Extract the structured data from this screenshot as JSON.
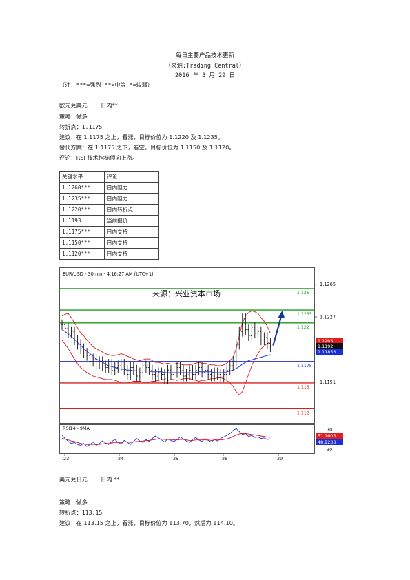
{
  "header": {
    "title": "每日主要产品技术更新",
    "source": "（来源:Trading Central）",
    "date": "2016 年 3 月 29 日",
    "note": "（注：***=强烈 **=中等 *=较弱）"
  },
  "eurusd": {
    "pair": "欧元兑美元",
    "term": "日内**",
    "strategy": "策略：做多",
    "pivot": "转折点：1.1175",
    "advice": "建议：在 1.1175 之上，看涨，目标价位为 1.1220 及 1.1235。",
    "alternative": "替代方案：在 1.1175 之下，看空，目标价位为 1.1150 及 1.1120。",
    "comment": "评论：RSI 技术指标倾向上涨。"
  },
  "levels_table": {
    "headers": [
      "关键水平",
      "评论"
    ],
    "rows": [
      [
        "1.1260***",
        "日内阻力"
      ],
      [
        "1.1235***",
        "日内阻力"
      ],
      [
        "1.1220***",
        "日内转折点"
      ],
      [
        "1.1193",
        "当前报价"
      ],
      [
        "1.1175***",
        "日内支持"
      ],
      [
        "1.1150***",
        "日内支持"
      ],
      [
        "1.1120***",
        "日内支持"
      ]
    ]
  },
  "chart_data": {
    "type": "line",
    "title": "EUR/USD - 30min - 4:16:27 AM (UTC+1)",
    "watermark": "来源：兴业资本市场",
    "x_ticks": [
      "23",
      "24",
      "25",
      "28",
      "29"
    ],
    "y_axis_ticks": [
      "1.1265",
      "1.1227",
      "1.1151"
    ],
    "levels": [
      {
        "value": 1.126,
        "label": "1.126",
        "color": "#1e9a1e"
      },
      {
        "value": 1.1235,
        "label": "1.1235",
        "color": "#1e9a1e"
      },
      {
        "value": 1.122,
        "label": "1.122",
        "color": "#1e9a1e"
      },
      {
        "value": 1.1175,
        "label": "1.1175",
        "color": "#1a2fd6"
      },
      {
        "value": 1.115,
        "label": "1.115",
        "color": "#d62020"
      },
      {
        "value": 1.112,
        "label": "1.112",
        "color": "#d62020"
      }
    ],
    "price_tags": [
      {
        "value": 1.1203,
        "label": "1.1203",
        "bg": "#e02020"
      },
      {
        "value": 1.1192,
        "label": "1.1192",
        "bg": "#111111"
      },
      {
        "value": 1.11833,
        "label": "1.11833",
        "bg": "#1a2fd6"
      }
    ],
    "ylim": [
      1.1105,
      1.1272
    ],
    "close": [
      1.1218,
      1.1214,
      1.1208,
      1.121,
      1.12,
      1.1195,
      1.119,
      1.1185,
      1.1182,
      1.1175,
      1.1178,
      1.1172,
      1.1175,
      1.117,
      1.1168,
      1.1172,
      1.1165,
      1.1168,
      1.117,
      1.1172,
      1.1165,
      1.116,
      1.1168,
      1.1165,
      1.1158,
      1.1162,
      1.117,
      1.1168,
      1.1165,
      1.116,
      1.1158,
      1.1162,
      1.116,
      1.1155,
      1.1165,
      1.116,
      1.1162,
      1.1168,
      1.1165,
      1.1158,
      1.116,
      1.1165,
      1.116,
      1.1165,
      1.1168,
      1.1162,
      1.1165,
      1.116,
      1.1158,
      1.1162,
      1.116,
      1.1157,
      1.116,
      1.1165,
      1.117,
      1.1175,
      1.1195,
      1.121,
      1.1225,
      1.1212,
      1.1205,
      1.1215,
      1.1208,
      1.121,
      1.12,
      1.1203,
      1.1196,
      1.1192
    ],
    "sma": [
      1.1212,
      1.121,
      1.1207,
      1.1204,
      1.1201,
      1.1197,
      1.1194,
      1.119,
      1.1187,
      1.1184,
      1.1181,
      1.1178,
      1.1176,
      1.1174,
      1.1172,
      1.117,
      1.1169,
      1.1168,
      1.1167,
      1.1166,
      1.1166,
      1.1165,
      1.1165,
      1.1164,
      1.1164,
      1.1164,
      1.1164,
      1.1164,
      1.1164,
      1.1163,
      1.1163,
      1.1163,
      1.1163,
      1.1162,
      1.1162,
      1.1162,
      1.1162,
      1.1162,
      1.1162,
      1.1162,
      1.1162,
      1.1162,
      1.1162,
      1.1162,
      1.1163,
      1.1163,
      1.1163,
      1.1163,
      1.1163,
      1.1162,
      1.1162,
      1.1162,
      1.1162,
      1.1163,
      1.1164,
      1.1165,
      1.1167,
      1.1169,
      1.1172,
      1.1174,
      1.1176,
      1.1177,
      1.1178,
      1.1179,
      1.118,
      1.1181,
      1.1182,
      1.1183
    ],
    "bb_upper": [
      1.1228,
      1.123,
      1.1231,
      1.1226,
      1.122,
      1.1214,
      1.1208,
      1.1205,
      1.12,
      1.1196,
      1.1192,
      1.119,
      1.1188,
      1.1186,
      1.1184,
      1.1183,
      1.1182,
      1.1182,
      1.1183,
      1.1184,
      1.1183,
      1.1181,
      1.118,
      1.1178,
      1.1177,
      1.1176,
      1.1177,
      1.1178,
      1.1178,
      1.1176,
      1.1174,
      1.1174,
      1.1173,
      1.1172,
      1.1173,
      1.1172,
      1.1172,
      1.1173,
      1.1172,
      1.1171,
      1.1171,
      1.1171,
      1.1172,
      1.1173,
      1.1174,
      1.1173,
      1.1173,
      1.1172,
      1.1171,
      1.1171,
      1.117,
      1.117,
      1.1171,
      1.1173,
      1.1176,
      1.118,
      1.119,
      1.1205,
      1.122,
      1.1228,
      1.1232,
      1.1234,
      1.1233,
      1.1231,
      1.1226,
      1.1222,
      1.1216,
      1.1208
    ],
    "bb_lower": [
      1.12,
      1.1195,
      1.119,
      1.1184,
      1.1178,
      1.1172,
      1.1168,
      1.1165,
      1.1162,
      1.116,
      1.1158,
      1.1157,
      1.1156,
      1.1155,
      1.1154,
      1.1154,
      1.1154,
      1.1153,
      1.1152,
      1.115,
      1.115,
      1.115,
      1.1151,
      1.1152,
      1.1152,
      1.1152,
      1.1151,
      1.115,
      1.1151,
      1.1152,
      1.1152,
      1.1153,
      1.1154,
      1.1154,
      1.1153,
      1.1154,
      1.1154,
      1.1153,
      1.1154,
      1.1155,
      1.1155,
      1.1155,
      1.1154,
      1.1153,
      1.1152,
      1.1153,
      1.1153,
      1.1154,
      1.1155,
      1.1155,
      1.1156,
      1.1156,
      1.1155,
      1.1153,
      1.115,
      1.1146,
      1.114,
      1.1136,
      1.114,
      1.115,
      1.116,
      1.117,
      1.1178,
      1.1184,
      1.119,
      1.1193,
      1.1196,
      1.1198
    ],
    "forecast_target": 1.1235,
    "rsi": {
      "label": "RSI14 - 9MA",
      "y_ticks": [
        "70",
        "30"
      ],
      "ylim": [
        25,
        75
      ],
      "tags": [
        {
          "value": 51.1605,
          "label": "51.1605",
          "bg": "#e02020"
        },
        {
          "value": 48.9233,
          "label": "48.9233",
          "bg": "#1a2fd6"
        }
      ],
      "rsi": [
        58,
        52,
        46,
        42,
        44,
        40,
        38,
        42,
        36,
        40,
        45,
        38,
        42,
        47,
        43,
        40,
        46,
        50,
        44,
        41,
        48,
        44,
        40,
        46,
        52,
        47,
        44,
        50,
        46,
        52,
        57,
        53,
        49,
        45,
        51,
        48,
        46,
        50,
        55,
        51,
        47,
        44,
        50,
        54,
        49,
        46,
        52,
        48,
        45,
        50,
        47,
        52,
        55,
        58,
        62,
        68,
        72,
        66,
        60,
        62,
        56,
        58,
        54,
        55,
        52,
        53,
        50,
        51
      ],
      "ma": [
        52,
        51,
        49,
        47,
        46,
        44,
        42,
        41,
        40,
        40,
        40,
        40,
        40,
        41,
        42,
        42,
        43,
        44,
        44,
        44,
        45,
        45,
        44,
        45,
        46,
        46,
        47,
        48,
        48,
        49,
        50,
        51,
        51,
        50,
        50,
        50,
        49,
        49,
        50,
        50,
        49,
        48,
        48,
        49,
        49,
        49,
        49,
        49,
        48,
        49,
        49,
        49,
        50,
        51,
        53,
        56,
        59,
        61,
        62,
        62,
        61,
        60,
        59,
        58,
        57,
        56,
        55,
        54
      ]
    }
  },
  "usdjpy": {
    "pair": "美元兑日元",
    "term": "日内 **",
    "strategy": "策略：做多",
    "pivot": "转折点：113.15",
    "advice": "建议：在 113.15 之上，看涨，目标价位为 113.70，然后为 114.10。"
  }
}
